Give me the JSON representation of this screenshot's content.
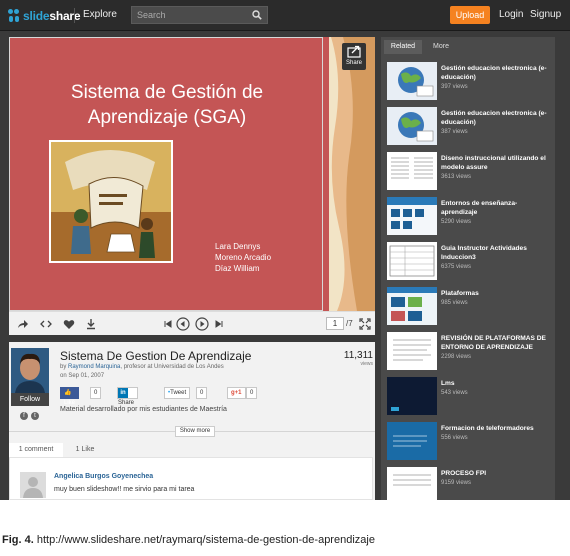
{
  "topbar": {
    "logo_slide": "slide",
    "logo_share": "share",
    "explore": "Explore",
    "search_placeholder": "Search",
    "upload": "Upload",
    "login": "Login",
    "signup": "Signup"
  },
  "slide": {
    "title_line1": "Sistema de Gestión de",
    "title_line2": "Aprendizaje (SGA)",
    "author1": "Lara Dennys",
    "author2": "Moreno Arcadio",
    "author3": "Díaz William",
    "share_label": "Share",
    "current_page": "1",
    "total_pages": "/7"
  },
  "info": {
    "title": "Sistema De Gestion De Aprendizaje",
    "by": "by",
    "author": "Raymond Marquina",
    "author_role": ", profesor at Universidad de Los Andes",
    "date": "on Sep 01, 2007",
    "views": "11,311",
    "views_label": "views",
    "follow": "Follow",
    "like_label": "Like",
    "like_count": "0",
    "share_label": "Share",
    "tweet_label": "Tweet",
    "tweet_count": "0",
    "gplus_label": "+1",
    "gplus_count": "0",
    "description": "Material desarrollado por mis estudiantes de Maestría",
    "show_more": "Show more",
    "tab_comments": "1 comment",
    "tab_likes": "1 Like",
    "comment_author": "Angelica Burgos Goyenechea",
    "comment_text": "muy buen slideshow!! me sirvio para mi tarea"
  },
  "sidebar": {
    "tab_related": "Related",
    "tab_more": "More",
    "items": [
      {
        "title": "Gestión educacion electronica (e-educación)",
        "views": "397 views"
      },
      {
        "title": "Gestión educacion electronica (e-educación)",
        "views": "387 views"
      },
      {
        "title": "Diseno instruccional utilizando el modelo assure",
        "views": "3613 views"
      },
      {
        "title": "Entornos de enseñanza-aprendizaje",
        "views": "5290 views"
      },
      {
        "title": "Guia Instructor Actividades Induccion3",
        "views": "6375 views"
      },
      {
        "title": "Plataformas",
        "views": "985 views"
      },
      {
        "title": "REVISIÓN DE PLATAFORMAS DE ENTORNO DE APRENDIZAJE",
        "views": "2298 views"
      },
      {
        "title": "Lms",
        "views": "543 views"
      },
      {
        "title": "Formacion de teleformadores",
        "views": "556 views"
      },
      {
        "title": "PROCESO FPI",
        "views": "9159 views"
      }
    ]
  },
  "caption": {
    "label": "Fig. 4.",
    "url": "http://www.slideshare.net/raymarq/sistema-de-gestion-de-aprendizaje"
  },
  "colors": {
    "slide_bg": "#c45555",
    "upload_orange": "#f58220",
    "brand_blue": "#2fa3d5",
    "link_blue": "#2a6496"
  }
}
